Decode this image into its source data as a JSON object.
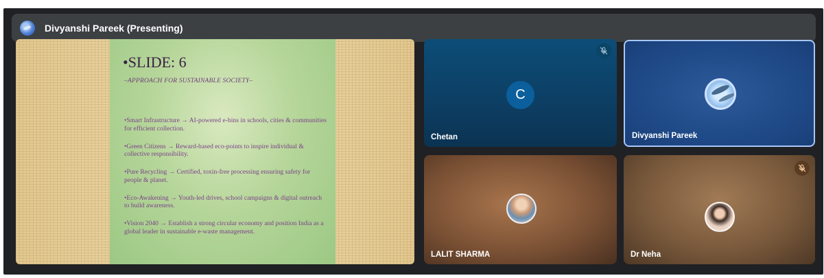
{
  "presenter": {
    "name": "Divyanshi Pareek (Presenting)"
  },
  "slide": {
    "title": "•SLIDE: 6",
    "subtitle": "–APPROACH FOR SUSTAINABLE SOCIETY–",
    "bullets": [
      "•Smart Infrastructure → AI-powered e-bins in schools, cities & communities for efficient collection.",
      "•Green Citizens → Reward-based eco-points to inspire individual & collective responsibility.",
      "•Pure Recycling → Certified, toxin-free processing ensuring safety for people & planet.",
      "•Eco-Awakening → Youth-led drives, school campaigns & digital outreach to build awareness.",
      "•Vision 2040 → Establish a strong circular economy and position India as a global leader in sustainable e-waste management."
    ]
  },
  "participants": [
    {
      "name": "Chetan",
      "initial": "C",
      "muted": true,
      "avatar": "initial-avatar"
    },
    {
      "name": "Divyanshi Pareek",
      "muted": false,
      "active_speaker": true,
      "avatar": "fish-photo-avatar"
    },
    {
      "name": "LALIT SHARMA",
      "muted": false,
      "avatar": "photo-avatar"
    },
    {
      "name": "Dr Neha",
      "muted": true,
      "avatar": "photo-avatar"
    }
  ],
  "icons": {
    "mute": "mic-off-icon",
    "presenter": "presenter-avatar"
  },
  "colors": {
    "background": "#202124",
    "presenter_bar": "#3c4043",
    "active_border": "#a8c7fa",
    "slide_text": "#7b3f8a"
  }
}
